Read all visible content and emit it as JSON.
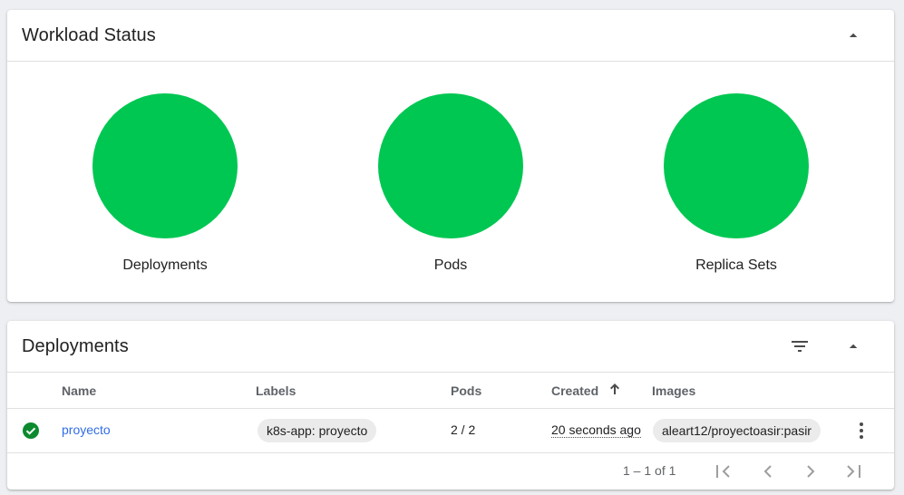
{
  "workload": {
    "title": "Workload Status",
    "collapse_icon": "arrow-up-icon",
    "items": [
      {
        "label": "Deployments",
        "color": "#00c752"
      },
      {
        "label": "Pods",
        "color": "#00c752"
      },
      {
        "label": "Replica Sets",
        "color": "#00c752"
      }
    ]
  },
  "deployments": {
    "title": "Deployments",
    "filter_icon": "filter-icon",
    "collapse_icon": "arrow-up-icon",
    "columns": {
      "name": "Name",
      "labels": "Labels",
      "pods": "Pods",
      "created": "Created",
      "images": "Images"
    },
    "sort_icon": "arrow-upward-icon",
    "rows": [
      {
        "status_icon": "check-circle-icon",
        "status_color": "#0c8a2e",
        "name": "proyecto",
        "label": "k8s-app: proyecto",
        "pods": "2 / 2",
        "created": "20 seconds ago",
        "image": "aleart12/proyectoasir:pasir"
      }
    ],
    "pagination": {
      "range": "1 – 1 of 1"
    }
  }
}
